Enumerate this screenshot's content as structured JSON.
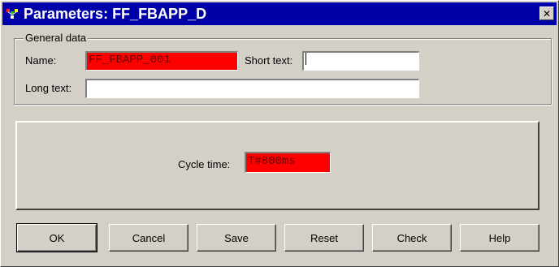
{
  "window": {
    "title": "Parameters: FF_FBAPP_D",
    "icon": "step7-app-icon",
    "close_label": "✕"
  },
  "general": {
    "group_label": "General data",
    "name_label": "Name:",
    "name_value": "FF_FBAPP_001",
    "short_text_label": "Short text:",
    "short_text_value": "",
    "long_text_label": "Long text:",
    "long_text_value": ""
  },
  "cycle": {
    "label": "Cycle time:",
    "value": "T#800ms"
  },
  "buttons": {
    "ok": "OK",
    "cancel": "Cancel",
    "save": "Save",
    "reset": "Reset",
    "check": "Check",
    "help": "Help"
  },
  "colors": {
    "title_bar": "#0000a8",
    "face": "#d4d0c8",
    "highlight_field": "#ff0000"
  }
}
